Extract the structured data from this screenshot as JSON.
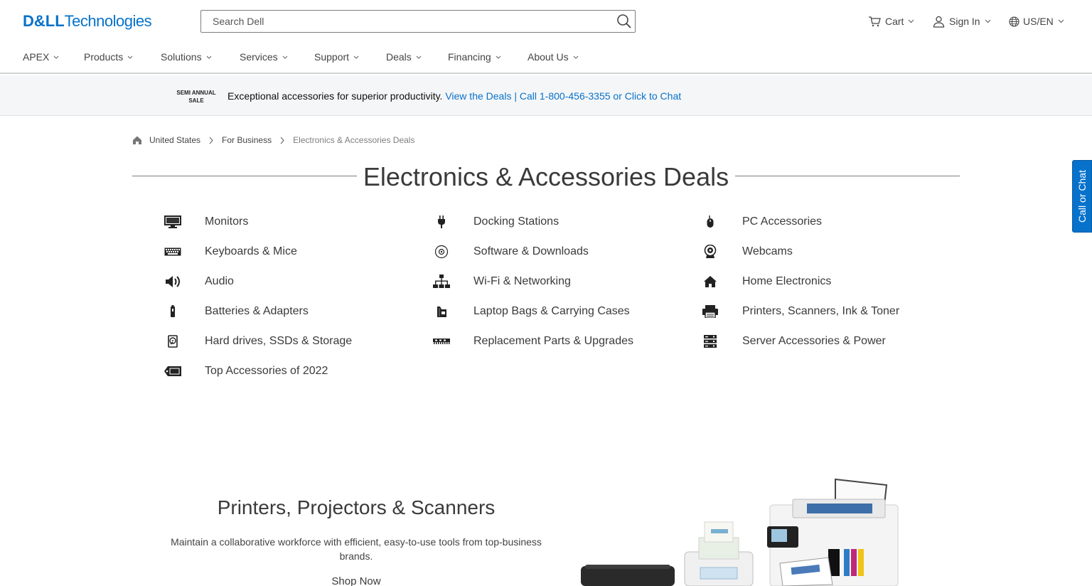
{
  "header": {
    "logo_left": "D&LL",
    "logo_right": "Technologies",
    "search_placeholder": "Search Dell",
    "cart_label": "Cart",
    "signin_label": "Sign In",
    "locale_label": "US/EN"
  },
  "nav": {
    "items": [
      {
        "label": "APEX"
      },
      {
        "label": "Products"
      },
      {
        "label": "Solutions"
      },
      {
        "label": "Services"
      },
      {
        "label": "Support"
      },
      {
        "label": "Deals"
      },
      {
        "label": "Financing"
      },
      {
        "label": "About Us"
      }
    ]
  },
  "promo": {
    "badge_line1": "SEMI ANNUAL",
    "badge_line2": "SALE",
    "text": "Exceptional accessories for superior productivity.",
    "link1": "View the Deals",
    "separator": "|",
    "link2": "Call 1-800-456-3355 or Click to Chat"
  },
  "breadcrumb": {
    "items": [
      "United States",
      "For Business",
      "Electronics & Accessories Deals"
    ]
  },
  "page": {
    "title": "Electronics & Accessories Deals"
  },
  "categories": {
    "col1": [
      {
        "label": "Monitors",
        "icon": "monitor-icon"
      },
      {
        "label": "Keyboards & Mice",
        "icon": "keyboard-icon"
      },
      {
        "label": "Audio",
        "icon": "speaker-icon"
      },
      {
        "label": "Batteries & Adapters",
        "icon": "battery-icon"
      },
      {
        "label": "Hard drives, SSDs & Storage",
        "icon": "hard-drive-icon"
      },
      {
        "label": "Top Accessories of 2022",
        "icon": "tag-icon"
      }
    ],
    "col2": [
      {
        "label": "Docking Stations",
        "icon": "plug-icon"
      },
      {
        "label": "Software & Downloads",
        "icon": "disc-icon"
      },
      {
        "label": "Wi-Fi & Networking",
        "icon": "network-icon"
      },
      {
        "label": "Laptop Bags & Carrying Cases",
        "icon": "bag-icon"
      },
      {
        "label": "Replacement Parts & Upgrades",
        "icon": "memory-icon"
      }
    ],
    "col3": [
      {
        "label": "PC Accessories",
        "icon": "mouse-icon"
      },
      {
        "label": "Webcams",
        "icon": "webcam-icon"
      },
      {
        "label": "Home Electronics",
        "icon": "home-icon"
      },
      {
        "label": "Printers, Scanners, Ink & Toner",
        "icon": "printer-icon"
      },
      {
        "label": "Server Accessories & Power",
        "icon": "server-icon"
      }
    ]
  },
  "chat_tab": {
    "label": "Call or Chat"
  },
  "feature": {
    "title": "Printers, Projectors & Scanners",
    "description": "Maintain a collaborative workforce with efficient, easy-to-use tools from top-business brands.",
    "cta": "Shop Now"
  },
  "colors": {
    "brand": "#0672cb",
    "text": "#3a3a3a",
    "banner_bg": "#f5f6f7"
  }
}
